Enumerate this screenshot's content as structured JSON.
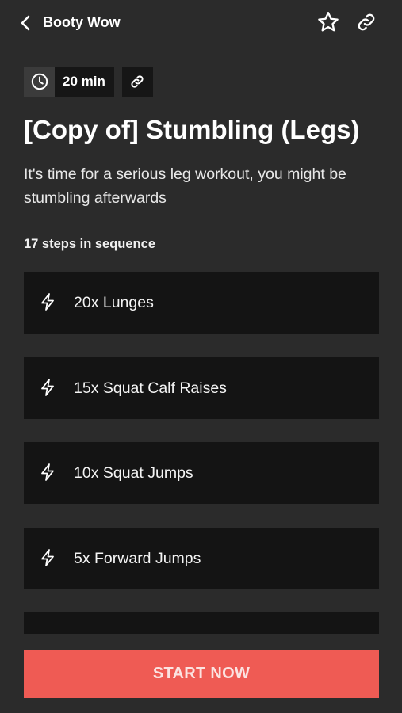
{
  "header": {
    "title": "Booty Wow",
    "back_icon": "chevron-left-icon",
    "favorite_icon": "star-outline-icon",
    "share_icon": "link-icon"
  },
  "workout": {
    "duration": "20 min",
    "title": "[Copy of] Stumbling (Legs)",
    "description": "It's time for a serious leg workout, you might be stumbling afterwards",
    "steps_count_label": "17 steps in sequence",
    "steps": [
      {
        "label": "20x Lunges",
        "icon": "lightning-icon"
      },
      {
        "label": "15x Squat Calf Raises",
        "icon": "lightning-icon"
      },
      {
        "label": "10x Squat Jumps",
        "icon": "lightning-icon"
      },
      {
        "label": "5x Forward Jumps",
        "icon": "lightning-icon"
      }
    ]
  },
  "cta": {
    "start_label": "START NOW"
  },
  "colors": {
    "background": "#2b2b2b",
    "card": "#141414",
    "accent": "#ef5b54",
    "text": "#ffffff"
  }
}
